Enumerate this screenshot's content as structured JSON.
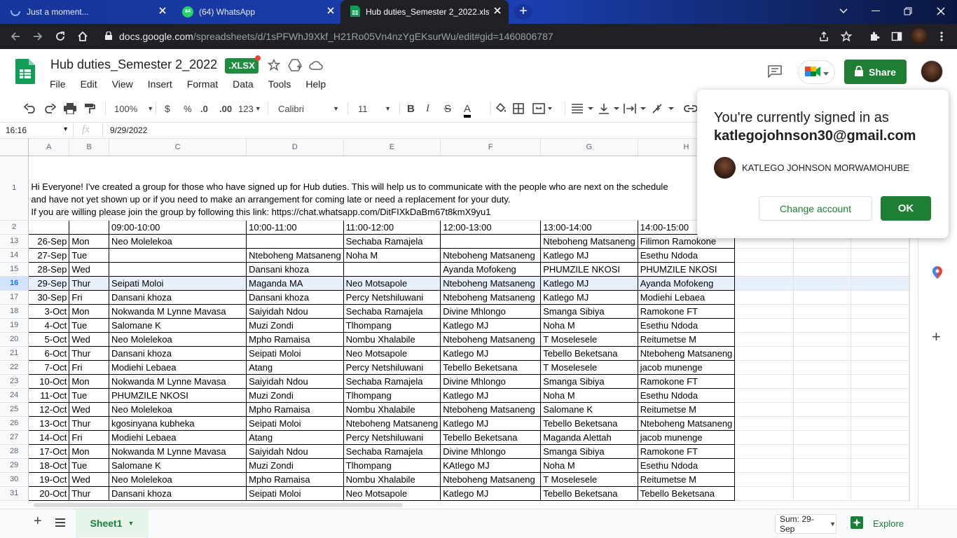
{
  "browser": {
    "tabs": [
      {
        "title": "Just a moment...",
        "active": false
      },
      {
        "title": "(64) WhatsApp",
        "active": false,
        "badge": "64"
      },
      {
        "title": "Hub duties_Semester 2_2022.xlsx",
        "active": true
      }
    ],
    "new_tab": "+",
    "url_host": "docs.google.com",
    "url_path": "/spreadsheets/d/1sPFWhJ9Xkf_H21Ro05Vn4nzYgEKsurWu/edit#gid=1460806787"
  },
  "doc": {
    "title": "Hub duties_Semester 2_2022",
    "badge": ".XLSX",
    "menu": [
      "File",
      "Edit",
      "View",
      "Insert",
      "Format",
      "Data",
      "Tools",
      "Help"
    ],
    "share_label": "Share"
  },
  "toolbar": {
    "zoom": "100%",
    "currency": "$",
    "percent": "%",
    "dec_less": ".0",
    "dec_more": ".00",
    "format_more": "123",
    "font": "Calibri",
    "size": "11",
    "bold": "B",
    "italic": "I",
    "strike": "S",
    "textcolor": "A"
  },
  "formula": {
    "cellref": "16:16",
    "fx": "fx",
    "value": "9/29/2022"
  },
  "sheet": {
    "columns": [
      "A",
      "B",
      "C",
      "D",
      "E",
      "F",
      "G",
      "H",
      "",
      "",
      ""
    ],
    "note_lines": [
      "Hi Everyone! I've created a group for those who have signed up for Hub duties. This will help us to communicate with the people who are next on the schedule",
      "and have not yet shown up or if you need to make an arrangement for coming late or need a replacement for your duty.",
      "If you are willing please join the group by following this link: https://chat.whatsapp.com/DitFIXkDaBm67t8kmX9yu1"
    ],
    "header_row": {
      "rn": "2",
      "cells": [
        "",
        "",
        "09:00-10:00",
        "10:00-11:00",
        "11:00-12:00",
        "12:00-13:00",
        "13:00-14:00",
        "14:00-15:00"
      ]
    },
    "rows": [
      {
        "rn": "13",
        "date": "26-Sep",
        "day": "Mon",
        "c": "Neo Molelekoa",
        "d": "",
        "e": "Sechaba Ramajela",
        "f": "",
        "g": "Nteboheng Matsaneng",
        "h": "Filimon Ramokone"
      },
      {
        "rn": "14",
        "date": "27-Sep",
        "day": "Tue",
        "c": "",
        "d": "Nteboheng Matsaneng",
        "e": "Noha M",
        "f": "Nteboheng Matsaneng",
        "g": "Katlego MJ",
        "h": "Esethu Ndoda"
      },
      {
        "rn": "15",
        "date": "28-Sep",
        "day": "Wed",
        "c": "",
        "d": "Dansani khoza",
        "e": "",
        "f": "Ayanda Mofokeng",
        "g": "PHUMZILE NKOSI",
        "h": "PHUMZILE NKOSI"
      },
      {
        "rn": "16",
        "date": "29-Sep",
        "day": "Thur",
        "c": "Seipati Moloi",
        "d": "Maganda MA",
        "e": "Neo Motsapole",
        "f": "Nteboheng Matsaneng",
        "g": "Katlego MJ",
        "h": "Ayanda Mofokeng",
        "selected": true
      },
      {
        "rn": "17",
        "date": "30-Sep",
        "day": "Fri",
        "c": "Dansani khoza",
        "d": "Dansani khoza",
        "e": "Percy Netshiluwani",
        "f": "Nteboheng Matsaneng",
        "g": "Katlego MJ",
        "h": "Modiehi Lebaea"
      },
      {
        "rn": "18",
        "date": "3-Oct",
        "day": "Mon",
        "c": "Nokwanda M Lynne Mavasa",
        "d": "Saiyidah Ndou",
        "e": "Sechaba Ramajela",
        "f": "Divine Mhlongo",
        "g": "Smanga Sibiya",
        "h": "Ramokone FT"
      },
      {
        "rn": "19",
        "date": "4-Oct",
        "day": "Tue",
        "c": "Salomane K",
        "d": "Muzi Zondi",
        "e": "Tlhompang",
        "f": "Katlego MJ",
        "g": "Noha M",
        "h": "Esethu Ndoda"
      },
      {
        "rn": "20",
        "date": "5-Oct",
        "day": "Wed",
        "c": "Neo Molelekoa",
        "d": "Mpho Ramaisa",
        "e": "Nombu Xhalabile",
        "f": "Nteboheng Matsaneng",
        "g": "T Moselesele",
        "h": "Reitumetse M"
      },
      {
        "rn": "21",
        "date": "6-Oct",
        "day": "Thur",
        "c": "Dansani khoza",
        "d": "Seipati Moloi",
        "e": "Neo Motsapole",
        "f": "Katlego MJ",
        "g": "Tebello Beketsana",
        "h": "Nteboheng Matsaneng"
      },
      {
        "rn": "22",
        "date": "7-Oct",
        "day": "Fri",
        "c": "Modiehi Lebaea",
        "d": "Atang",
        "e": "Percy Netshiluwani",
        "f": "Tebello Beketsana",
        "g": "T Moselesele",
        "h": "jacob munenge"
      },
      {
        "rn": "23",
        "date": "10-Oct",
        "day": "Mon",
        "c": "Nokwanda M Lynne Mavasa",
        "d": "Saiyidah Ndou",
        "e": "Sechaba Ramajela",
        "f": "Divine Mhlongo",
        "g": "Smanga Sibiya",
        "h": "Ramokone FT"
      },
      {
        "rn": "24",
        "date": "11-Oct",
        "day": "Tue",
        "c": "PHUMZILE NKOSI",
        "d": "Muzi Zondi",
        "e": "Tlhompang",
        "f": "Katlego MJ",
        "g": "Noha M",
        "h": "Esethu Ndoda"
      },
      {
        "rn": "25",
        "date": "12-Oct",
        "day": "Wed",
        "c": "Neo Molelekoa",
        "d": "Mpho Ramaisa",
        "e": "Nombu Xhalabile",
        "f": "Nteboheng Matsaneng",
        "g": "Salomane K",
        "h": "Reitumetse M"
      },
      {
        "rn": "26",
        "date": "13-Oct",
        "day": "Thur",
        "c": "kgosinyana kubheka",
        "d": "Seipati Moloi",
        "e": "Nteboheng Matsaneng",
        "f": "Katlego MJ",
        "g": "Tebello Beketsana",
        "h": "Nteboheng Matsaneng"
      },
      {
        "rn": "27",
        "date": "14-Oct",
        "day": "Fri",
        "c": "Modiehi Lebaea",
        "d": "Atang",
        "e": "Percy Netshiluwani",
        "f": "Tebello Beketsana",
        "g": "Maganda Alettah",
        "h": "jacob munenge"
      },
      {
        "rn": "28",
        "date": "17-Oct",
        "day": "Mon",
        "c": "Nokwanda M Lynne Mavasa",
        "d": "Saiyidah Ndou",
        "e": "Sechaba Ramajela",
        "f": "Divine Mhlongo",
        "g": "Smanga Sibiya",
        "h": "Ramokone FT"
      },
      {
        "rn": "29",
        "date": "18-Oct",
        "day": "Tue",
        "c": "Salomane K",
        "d": "Muzi Zondi",
        "e": "Tlhompang",
        "f": "KAtlego MJ",
        "g": "Noha M",
        "h": "Esethu Ndoda"
      },
      {
        "rn": "30",
        "date": "19-Oct",
        "day": "Wed",
        "c": "Neo Molelekoa",
        "d": "Mpho Ramaisa",
        "e": "Nombu Xhalabile",
        "f": "Nteboheng Matsaneng",
        "g": "T Moselesele",
        "h": "Reitumetse M"
      },
      {
        "rn": "31",
        "date": "20-Oct",
        "day": "Thur",
        "c": "Dansani khoza",
        "d": "Seipati Moloi",
        "e": "Neo Motsapole",
        "f": "Katlego MJ",
        "g": "Tebello Beketsana",
        "h": "Tebello Beketsana"
      }
    ]
  },
  "popup": {
    "line1": "You're currently signed in as",
    "email": "katlegojohnson30@gmail.com",
    "name": "KATLEGO JOHNSON MORWAMOHUBE",
    "change_label": "Change account",
    "ok_label": "OK"
  },
  "bottom": {
    "add": "+",
    "sheet_tab": "Sheet1",
    "sum": "Sum: 29-Sep",
    "explore": "Explore"
  },
  "colors": {
    "accent_green": "#1e7e34",
    "tabbar_blue": "#17359a",
    "selection": "#e8f0fe"
  }
}
